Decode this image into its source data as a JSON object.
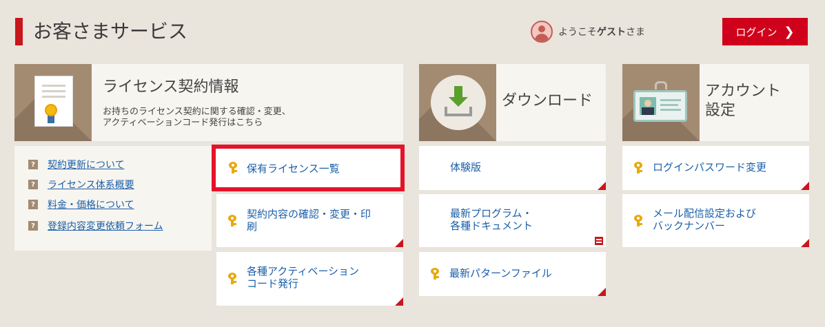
{
  "header": {
    "title": "お客さまサービス",
    "welcome_prefix": "ようこそ",
    "welcome_user": "ゲスト",
    "welcome_suffix": "さま",
    "login_label": "ログイン",
    "login_chevron": "❯"
  },
  "license_panel": {
    "title": "ライセンス契約情報",
    "desc_line1": "お持ちのライセンス契約に関する確認・変更、",
    "desc_line2": "アクティベーションコード発行はこちら",
    "icon": "certificate-icon"
  },
  "faq": {
    "items": [
      {
        "icon": "?",
        "label": "契約更新について"
      },
      {
        "icon": "?",
        "label": "ライセンス体系概要"
      },
      {
        "icon": "?",
        "label": "料金・価格について"
      },
      {
        "icon": "?",
        "label": "登録内容変更依頼フォーム"
      }
    ]
  },
  "license_links": [
    {
      "line1": "保有ライセンス一覧",
      "line2": ""
    },
    {
      "line1": "契約内容の確認・変更・印",
      "line2": "刷"
    },
    {
      "line1": "各種アクティベーション",
      "line2": "コード発行"
    }
  ],
  "download_panel": {
    "title": "ダウンロード",
    "icon": "download-icon",
    "links": [
      {
        "line1": "体験版",
        "line2": ""
      },
      {
        "line1": "最新プログラム・",
        "line2": "各種ドキュメント"
      },
      {
        "line1": "最新パターンファイル",
        "line2": ""
      }
    ]
  },
  "account_panel": {
    "title_line1": "アカウント",
    "title_line2": "設定",
    "icon": "id-card-icon",
    "links": [
      {
        "line1": "ログインパスワード変更",
        "line2": ""
      },
      {
        "line1": "メール配信設定および",
        "line2": "バックナンバー"
      }
    ]
  },
  "colors": {
    "accent_red": "#c8161d",
    "link_blue": "#1a5fa8",
    "panel_brown": "#a38b72",
    "background": "#e9e4dc"
  }
}
